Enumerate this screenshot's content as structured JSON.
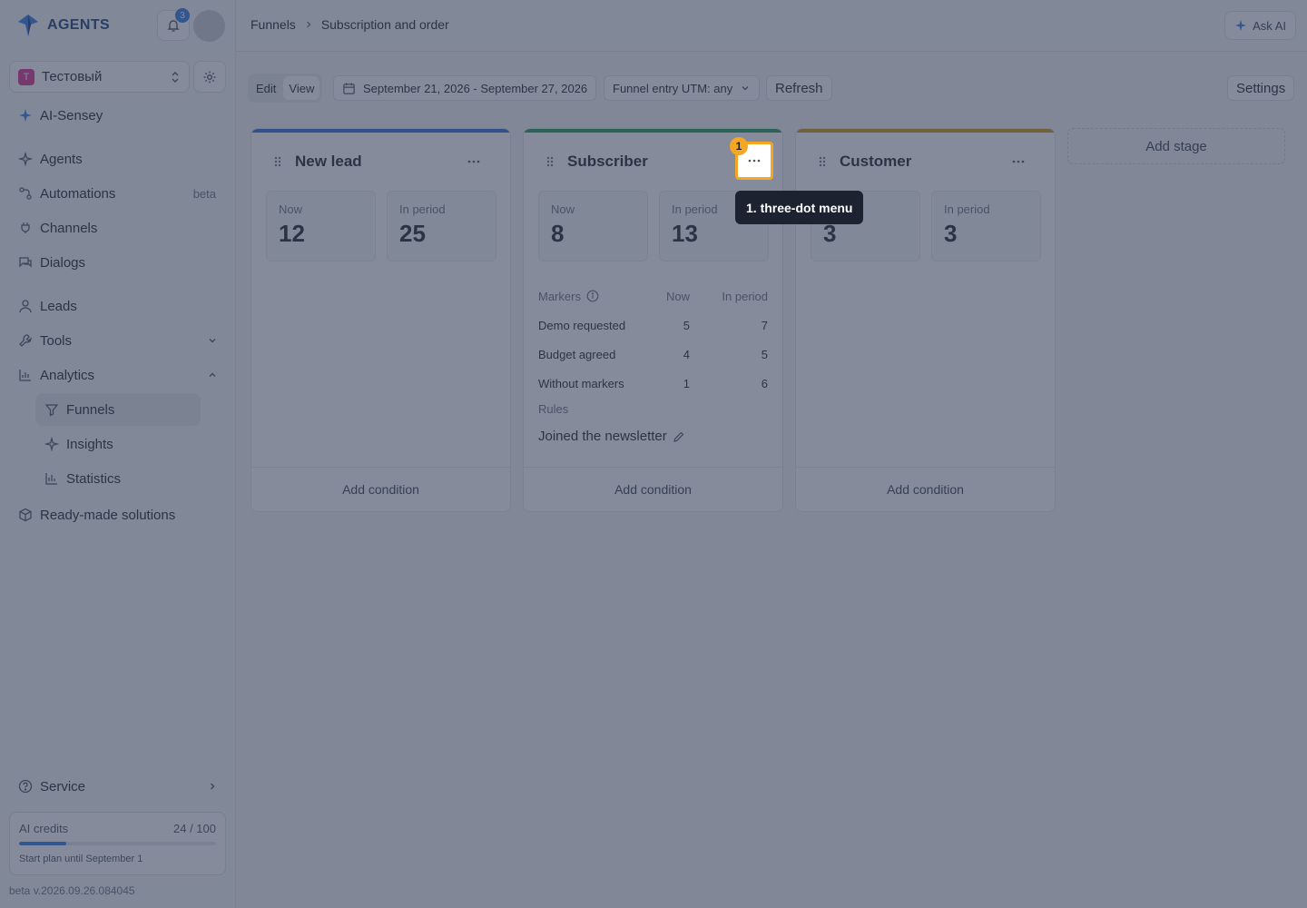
{
  "app": {
    "logo_text": "AGENTS",
    "notifications_count": "3",
    "workspace_letter": "T",
    "workspace_name": "Тестовый"
  },
  "sidebar": {
    "ai_item": "AI-Sensey",
    "items": [
      {
        "label": "Agents",
        "icon": "sparkle-icon"
      },
      {
        "label": "Automations",
        "badge": "beta",
        "icon": "flow-icon"
      },
      {
        "label": "Channels",
        "icon": "plug-icon"
      },
      {
        "label": "Dialogs",
        "icon": "chat-icon"
      },
      {
        "label": "Leads",
        "icon": "user-icon"
      },
      {
        "label": "Tools",
        "icon": "wrench-icon"
      },
      {
        "label": "Analytics",
        "icon": "chart-icon"
      },
      {
        "label": "Ready-made solutions",
        "icon": "box-icon"
      }
    ],
    "analytics_sub": [
      {
        "label": "Funnels",
        "icon": "funnel-icon",
        "active": true
      },
      {
        "label": "Insights",
        "icon": "sparkle-icon"
      },
      {
        "label": "Statistics",
        "icon": "bars-icon"
      }
    ],
    "service": "Service",
    "credits": {
      "label": "AI credits",
      "value": "24 / 100",
      "fraction": 0.24,
      "note": "Start plan until September 1"
    },
    "version": "beta v.2026.09.26.084045"
  },
  "header": {
    "breadcrumb_root": "Funnels",
    "breadcrumb_current": "Subscription and order",
    "ask_ai": "Ask AI"
  },
  "toolbar": {
    "edit": "Edit",
    "view": "View",
    "date_range": "September 21, 2026 - September 27, 2026",
    "utm_filter": "Funnel entry UTM: any",
    "refresh": "Refresh",
    "settings": "Settings"
  },
  "stages": [
    {
      "name": "New lead",
      "color": "#2f6fd6",
      "now_label": "Now",
      "period_label": "In period",
      "now": "12",
      "period": "25",
      "add_condition": "Add condition"
    },
    {
      "name": "Subscriber",
      "color": "#1f9d55",
      "now_label": "Now",
      "period_label": "In period",
      "now": "8",
      "period": "13",
      "markers_label": "Markers",
      "markers_now": "Now",
      "markers_period": "In period",
      "markers": [
        {
          "name": "Demo requested",
          "now": "5",
          "period": "7"
        },
        {
          "name": "Budget agreed",
          "now": "4",
          "period": "5"
        },
        {
          "name": "Without markers",
          "now": "1",
          "period": "6"
        }
      ],
      "rules_label": "Rules",
      "rule": "Joined the newsletter",
      "add_condition": "Add condition"
    },
    {
      "name": "Customer",
      "color": "#c9971c",
      "now_label": "Now",
      "period_label": "In period",
      "now": "3",
      "period": "3",
      "add_condition": "Add condition"
    }
  ],
  "add_stage": "Add stage",
  "highlight": {
    "badge": "1",
    "tooltip": "1. three-dot menu"
  }
}
